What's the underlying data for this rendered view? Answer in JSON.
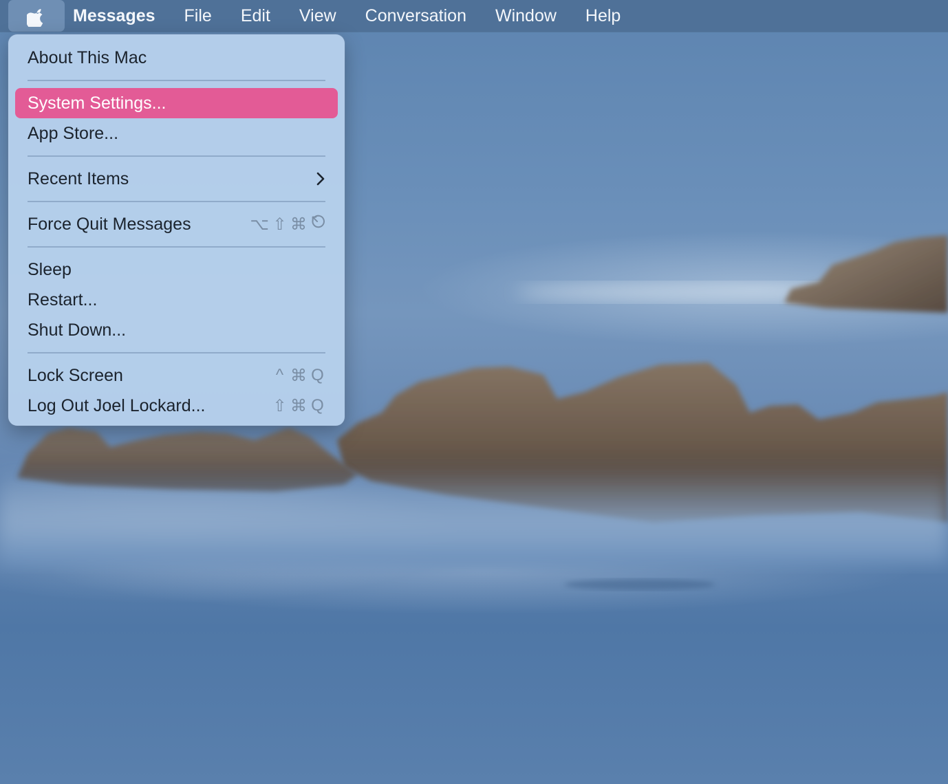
{
  "menubar": {
    "apple_icon": "apple-logo-icon",
    "app_name": "Messages",
    "items": [
      "File",
      "Edit",
      "View",
      "Conversation",
      "Window",
      "Help"
    ]
  },
  "apple_menu": {
    "highlight_color": "#e35b96",
    "items": [
      {
        "label": "About This Mac",
        "shortcut": []
      },
      {
        "separator": true
      },
      {
        "label": "System Settings...",
        "shortcut": [],
        "highlighted": true
      },
      {
        "label": "App Store...",
        "shortcut": []
      },
      {
        "separator": true
      },
      {
        "label": "Recent Items",
        "submenu": true,
        "submenu_icon": "chevron-right-icon"
      },
      {
        "separator": true
      },
      {
        "label": "Force Quit Messages",
        "shortcut": [
          "⌥",
          "⇧",
          "⌘",
          "⎋"
        ]
      },
      {
        "separator": true
      },
      {
        "label": "Sleep",
        "shortcut": []
      },
      {
        "label": "Restart...",
        "shortcut": []
      },
      {
        "label": "Shut Down...",
        "shortcut": []
      },
      {
        "separator": true
      },
      {
        "label": "Lock Screen",
        "shortcut": [
          "^",
          "⌘",
          "Q"
        ]
      },
      {
        "label": "Log Out Joel Lockard...",
        "shortcut": [
          "⇧",
          "⌘",
          "Q"
        ]
      }
    ]
  },
  "wallpaper": {
    "description": "misty ocean with rocky coastline",
    "water_color": "#5d84b0",
    "rock_color": "#6b5d50"
  }
}
